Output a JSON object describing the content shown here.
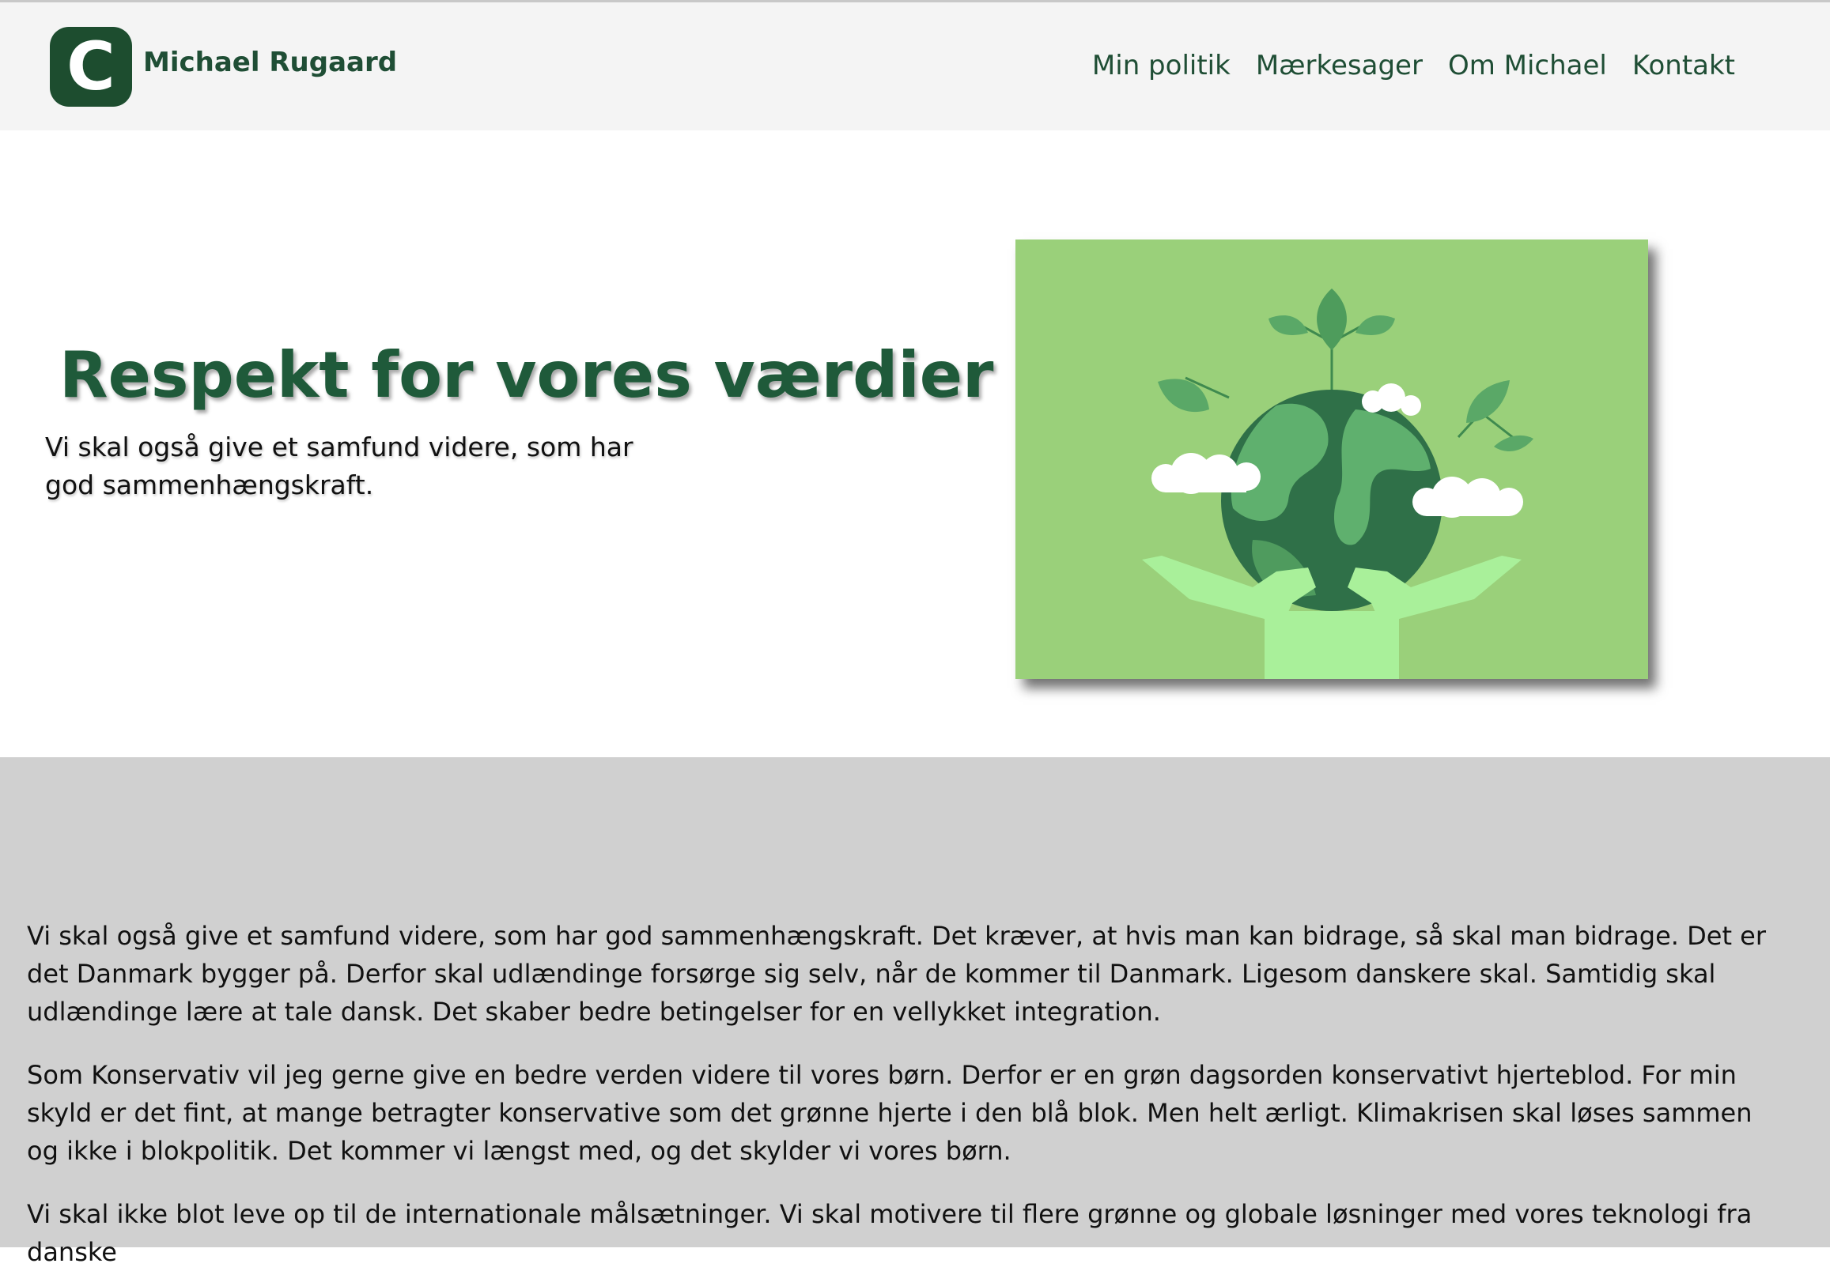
{
  "header": {
    "logo_letter": "C",
    "brand": "Michael Rugaard",
    "nav": [
      "Min politik",
      "Mærkesager",
      "Om Michael",
      "Kontakt"
    ]
  },
  "hero": {
    "title": "Respekt for vores værdier",
    "subtitle": "Vi skal også give et samfund videre, som har god sammenhængskraft.",
    "image_icon": "globe-in-hands-illustration"
  },
  "content": {
    "paragraphs": [
      "Vi skal også give et samfund videre, som har god sammenhængskraft. Det kræver, at hvis man kan bidrage, så skal man bidrage. Det er det Danmark bygger på. Derfor skal udlændinge forsørge sig selv, når de kommer til Danmark. Ligesom danskere skal. Samtidig skal udlændinge lære at tale dansk. Det skaber bedre betingelser for en vellykket integration.",
      "Som Konservativ vil jeg gerne give en bedre verden videre til vores børn. Derfor er en grøn dagsorden konservativt hjerteblod. For min skyld er det fint, at mange betragter konservative som det grønne hjerte i den blå blok. Men helt ærligt. Klimakrisen skal løses sammen og ikke i blokpolitik. Det kommer vi længst med, og det skylder vi vores børn.",
      "Vi skal ikke blot leve op til de internationale målsætninger. Vi skal motivere til flere grønne og globale løsninger med vores teknologi fra danske"
    ]
  },
  "colors": {
    "brand_green": "#1f4e35",
    "header_bg": "#f4f4f4",
    "content_bg": "#d0d0d0",
    "image_bg": "#9ad07a"
  }
}
